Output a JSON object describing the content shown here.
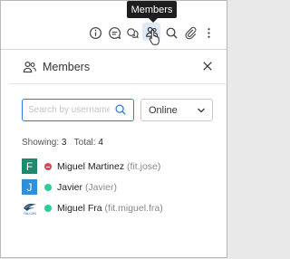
{
  "tooltip": {
    "text": "Members"
  },
  "toolbar": {
    "icons": [
      "info-icon",
      "chat-icon",
      "threads-icon",
      "members-icon",
      "search-icon",
      "attachment-icon",
      "more-vertical-icon"
    ],
    "active_icon": "members-icon"
  },
  "panel": {
    "title": "Members",
    "close_icon": "close-icon"
  },
  "search": {
    "placeholder": "Search by username",
    "value": ""
  },
  "status_filter": {
    "selected": "Online"
  },
  "counts": {
    "showing_label": "Showing:",
    "showing": "3",
    "total_label": "Total:",
    "total": "4"
  },
  "members": [
    {
      "initial": "F",
      "avatar_color": "#1f8a6d",
      "status": "busy",
      "status_color": "#e0455b",
      "name": "Miguel Martinez",
      "username": "(fit.jose)"
    },
    {
      "initial": "J",
      "avatar_color": "#2f8fd8",
      "status": "online",
      "status_color": "#2ecf8e",
      "name": "Javier",
      "username": "(Javier)"
    },
    {
      "logo_text": "FALCON",
      "status": "online",
      "status_color": "#2ecf8e",
      "name": "Miguel Fra",
      "username": "(fit.miguel.fra)"
    }
  ],
  "colors": {
    "accent": "#2f7ce0",
    "active_bg": "#dfe9f8"
  }
}
